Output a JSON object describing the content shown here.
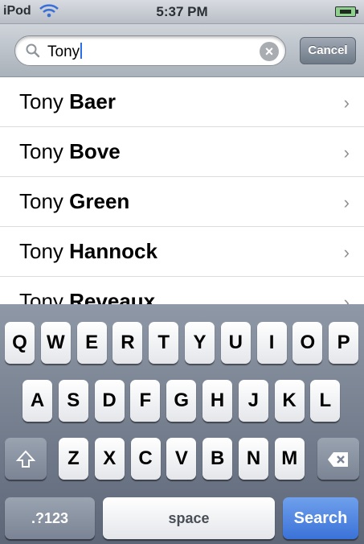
{
  "status_bar": {
    "carrier": "iPod",
    "time": "5:37 PM",
    "icons": [
      "wifi-icon",
      "battery-charging-icon"
    ]
  },
  "search": {
    "value": "Tony",
    "cancel_label": "Cancel"
  },
  "results": [
    {
      "first": "Tony",
      "last": "Baer"
    },
    {
      "first": "Tony",
      "last": "Bove"
    },
    {
      "first": "Tony",
      "last": "Green"
    },
    {
      "first": "Tony",
      "last": "Hannock"
    },
    {
      "first": "Tony",
      "last": "Reveaux"
    }
  ],
  "keyboard": {
    "row1": [
      "Q",
      "W",
      "E",
      "R",
      "T",
      "Y",
      "U",
      "I",
      "O",
      "P"
    ],
    "row2": [
      "A",
      "S",
      "D",
      "F",
      "G",
      "H",
      "J",
      "K",
      "L"
    ],
    "row3": [
      "Z",
      "X",
      "C",
      "V",
      "B",
      "N",
      "M"
    ],
    "numbers_label": ".?123",
    "space_label": "space",
    "search_label": "Search"
  },
  "colors": {
    "accent": "#3a72d8",
    "cancel": "#7a8494"
  }
}
